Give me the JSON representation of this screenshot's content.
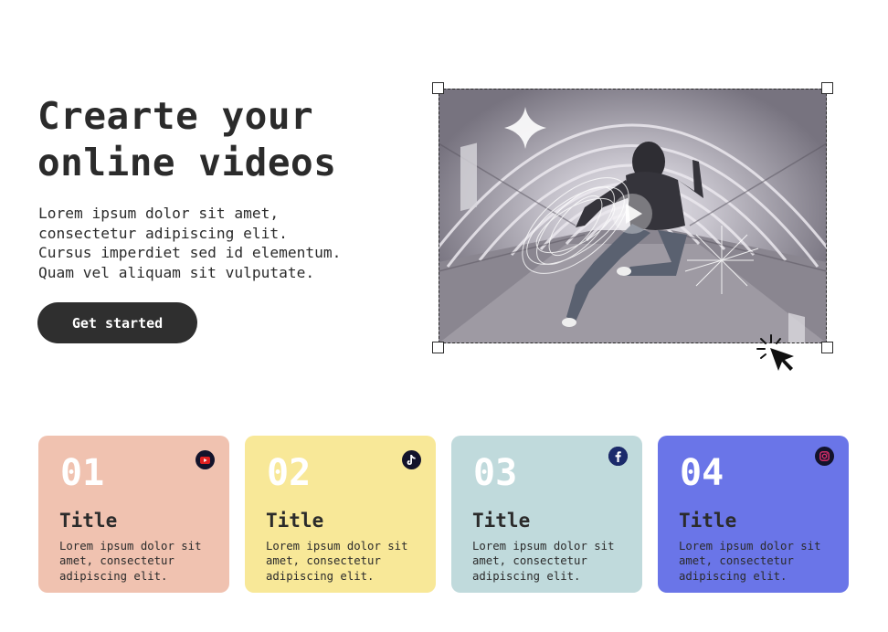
{
  "hero": {
    "title_lines": [
      "Crearte your",
      "online videos"
    ],
    "description_lines": [
      "Lorem ipsum dolor sit amet,",
      "consectetur adipiscing elit.",
      "Cursus imperdiet sed id elementum.",
      "Quam vel aliquam sit vulputate."
    ],
    "cta_label": "Get started"
  },
  "media": {
    "description": "video preview",
    "has_play_button": true
  },
  "cards": [
    {
      "number": "01",
      "title": "Title",
      "text_lines": [
        "Lorem ipsum dolor sit",
        "amet, consectetur",
        "adipiscing elit."
      ],
      "bg_color": "#f0c2b0",
      "icon": "youtube-icon",
      "icon_color": "#e02020"
    },
    {
      "number": "02",
      "title": "Title",
      "text_lines": [
        "Lorem ipsum dolor sit",
        "amet, consectetur",
        "adipiscing elit."
      ],
      "bg_color": "#f8e898",
      "icon": "tiktok-icon",
      "icon_color": "#ffffff"
    },
    {
      "number": "03",
      "title": "Title",
      "text_lines": [
        "Lorem ipsum dolor sit",
        "amet, consectetur",
        "adipiscing elit."
      ],
      "bg_color": "#c0dadc",
      "icon": "facebook-icon",
      "icon_color": "#1877f2"
    },
    {
      "number": "04",
      "title": "Title",
      "text_lines": [
        "Lorem ipsum dolor sit",
        "amet, consectetur",
        "adipiscing elit."
      ],
      "bg_color": "#6a75e8",
      "icon": "instagram-icon",
      "icon_color": "#e1306c"
    }
  ],
  "colors": {
    "text": "#2b2b2b",
    "button_bg": "#2f2f2f",
    "button_text": "#ffffff"
  }
}
